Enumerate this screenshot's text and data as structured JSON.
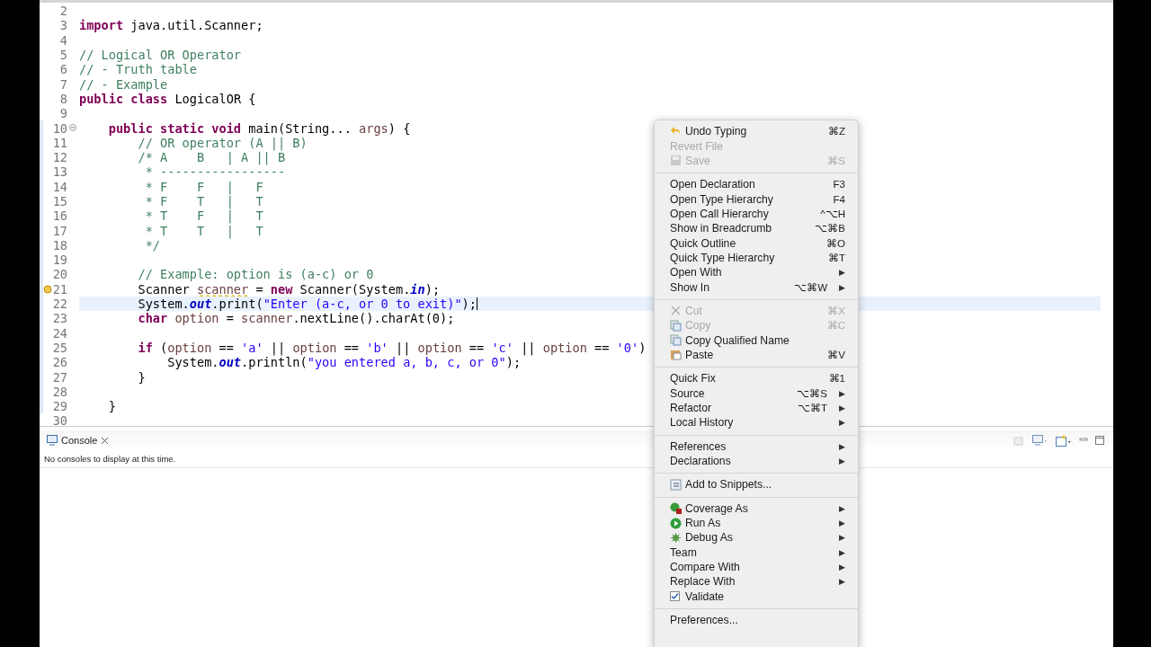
{
  "editor": {
    "lines": [
      {
        "number": "2",
        "current": false
      },
      {
        "number": "3",
        "current": false,
        "tokens": [
          {
            "kind": "keyword",
            "text": "import"
          },
          {
            "kind": "plain",
            "text": " java.util.Scanner;"
          }
        ]
      },
      {
        "number": "4",
        "current": false
      },
      {
        "number": "5",
        "current": false,
        "tokens": [
          {
            "kind": "comment",
            "text": "// Logical OR Operator"
          }
        ]
      },
      {
        "number": "6",
        "current": false,
        "tokens": [
          {
            "kind": "comment",
            "text": "// - Truth table"
          }
        ]
      },
      {
        "number": "7",
        "current": false,
        "tokens": [
          {
            "kind": "comment",
            "text": "// - Example"
          }
        ]
      },
      {
        "number": "8",
        "current": false,
        "tokens": [
          {
            "kind": "keyword",
            "text": "public class"
          },
          {
            "kind": "plain",
            "text": " LogicalOR {"
          }
        ]
      },
      {
        "number": "9",
        "current": false
      },
      {
        "number": "10",
        "current": false,
        "folding": true,
        "tokens": [
          {
            "kind": "keyword",
            "text": "    public static void"
          },
          {
            "kind": "plain",
            "text": " main(String... "
          },
          {
            "kind": "param",
            "text": "args"
          },
          {
            "kind": "plain",
            "text": ") {"
          }
        ]
      },
      {
        "number": "11",
        "current": false,
        "tokens": [
          {
            "kind": "comment",
            "text": "        // OR operator (A || B)"
          }
        ]
      },
      {
        "number": "12",
        "current": false,
        "tokens": [
          {
            "kind": "comment",
            "text": "        /* A    B   | A || B"
          }
        ]
      },
      {
        "number": "13",
        "current": false,
        "tokens": [
          {
            "kind": "comment",
            "text": "         * -----------------"
          }
        ]
      },
      {
        "number": "14",
        "current": false,
        "tokens": [
          {
            "kind": "comment",
            "text": "         * F    F   |   F"
          }
        ]
      },
      {
        "number": "15",
        "current": false,
        "tokens": [
          {
            "kind": "comment",
            "text": "         * F    T   |   T"
          }
        ]
      },
      {
        "number": "16",
        "current": false,
        "tokens": [
          {
            "kind": "comment",
            "text": "         * T    F   |   T"
          }
        ]
      },
      {
        "number": "17",
        "current": false,
        "tokens": [
          {
            "kind": "comment",
            "text": "         * T    T   |   T"
          }
        ]
      },
      {
        "number": "18",
        "current": false,
        "tokens": [
          {
            "kind": "comment",
            "text": "         */"
          }
        ]
      },
      {
        "number": "19",
        "current": false
      },
      {
        "number": "20",
        "current": false,
        "tokens": [
          {
            "kind": "comment",
            "text": "        // Example: option is (a-c) or 0"
          }
        ]
      },
      {
        "number": "21",
        "current": false,
        "warning": true,
        "tokens": [
          {
            "kind": "plain",
            "text": "        Scanner "
          },
          {
            "kind": "warning",
            "text": "scanner"
          },
          {
            "kind": "plain",
            "text": " = "
          },
          {
            "kind": "keyword",
            "text": "new"
          },
          {
            "kind": "plain",
            "text": " Scanner(System."
          },
          {
            "kind": "field",
            "text": "in"
          },
          {
            "kind": "plain",
            "text": ");"
          }
        ]
      },
      {
        "number": "22",
        "current": true,
        "tokens": [
          {
            "kind": "plain",
            "text": "        System."
          },
          {
            "kind": "field",
            "text": "out"
          },
          {
            "kind": "plain",
            "text": ".print("
          },
          {
            "kind": "string",
            "text": "\"Enter (a-c, or 0 to exit)\""
          },
          {
            "kind": "plain",
            "text": ");"
          }
        ]
      },
      {
        "number": "23",
        "current": false,
        "tokens": [
          {
            "kind": "keyword",
            "text": "        char"
          },
          {
            "kind": "param",
            "text": " option"
          },
          {
            "kind": "plain",
            "text": " = "
          },
          {
            "kind": "param",
            "text": "scanner"
          },
          {
            "kind": "plain",
            "text": ".nextLine().charAt(0);"
          }
        ]
      },
      {
        "number": "24",
        "current": false
      },
      {
        "number": "25",
        "current": false,
        "tokens": [
          {
            "kind": "keyword",
            "text": "        if"
          },
          {
            "kind": "plain",
            "text": " ("
          },
          {
            "kind": "param",
            "text": "option"
          },
          {
            "kind": "plain",
            "text": " == "
          },
          {
            "kind": "string",
            "text": "'a'"
          },
          {
            "kind": "plain",
            "text": " || "
          },
          {
            "kind": "param",
            "text": "option"
          },
          {
            "kind": "plain",
            "text": " == "
          },
          {
            "kind": "string",
            "text": "'b'"
          },
          {
            "kind": "plain",
            "text": " || "
          },
          {
            "kind": "param",
            "text": "option"
          },
          {
            "kind": "plain",
            "text": " == "
          },
          {
            "kind": "string",
            "text": "'c'"
          },
          {
            "kind": "plain",
            "text": " || "
          },
          {
            "kind": "param",
            "text": "option"
          },
          {
            "kind": "plain",
            "text": " == "
          },
          {
            "kind": "string",
            "text": "'0'"
          },
          {
            "kind": "plain",
            "text": ")"
          }
        ]
      },
      {
        "number": "26",
        "current": false,
        "tokens": [
          {
            "kind": "plain",
            "text": "            System."
          },
          {
            "kind": "field",
            "text": "out"
          },
          {
            "kind": "plain",
            "text": ".println("
          },
          {
            "kind": "string",
            "text": "\"you entered a, b, c, or 0\""
          },
          {
            "kind": "plain",
            "text": ");"
          }
        ]
      },
      {
        "number": "27",
        "current": false,
        "tokens": [
          {
            "kind": "plain",
            "text": "        }"
          }
        ]
      },
      {
        "number": "28",
        "current": false
      },
      {
        "number": "29",
        "current": false,
        "tokens": [
          {
            "kind": "plain",
            "text": "    }"
          }
        ]
      },
      {
        "number": "30",
        "current": false
      }
    ]
  },
  "console": {
    "tab": "Console",
    "message": "No consoles to display at this time."
  },
  "context_menu": {
    "items": [
      {
        "kind": "item",
        "label": "Undo Typing",
        "shortcut": "⌘Z",
        "disabled": false
      },
      {
        "kind": "item",
        "label": "Revert File",
        "disabled": true
      },
      {
        "kind": "item",
        "label": "Save",
        "shortcut": "⌘S",
        "disabled": true
      },
      {
        "kind": "separator"
      },
      {
        "kind": "item",
        "label": "Open Declaration",
        "shortcut": "F3",
        "disabled": false
      },
      {
        "kind": "item",
        "label": "Open Type Hierarchy",
        "shortcut": "F4",
        "disabled": false
      },
      {
        "kind": "item",
        "label": "Open Call Hierarchy",
        "shortcut": "^⌥H",
        "disabled": false
      },
      {
        "kind": "item",
        "label": "Show in Breadcrumb",
        "shortcut": "⌥⌘B",
        "disabled": false
      },
      {
        "kind": "item",
        "label": "Quick Outline",
        "shortcut": "⌘O",
        "disabled": false
      },
      {
        "kind": "item",
        "label": "Quick Type Hierarchy",
        "shortcut": "⌘T",
        "disabled": false
      },
      {
        "kind": "item",
        "label": "Open With",
        "submenu": "▶",
        "disabled": false
      },
      {
        "kind": "item",
        "label": "Show In",
        "shortcut": "⌥⌘W",
        "submenu": "▶",
        "disabled": false
      },
      {
        "kind": "separator"
      },
      {
        "kind": "item",
        "label": "Cut",
        "shortcut": "⌘X",
        "disabled": true
      },
      {
        "kind": "item",
        "label": "Copy",
        "shortcut": "⌘C",
        "disabled": true
      },
      {
        "kind": "item",
        "label": "Copy Qualified Name",
        "disabled": false
      },
      {
        "kind": "item",
        "label": "Paste",
        "shortcut": "⌘V",
        "disabled": false
      },
      {
        "kind": "separator"
      },
      {
        "kind": "item",
        "label": "Quick Fix",
        "shortcut": "⌘1",
        "disabled": false
      },
      {
        "kind": "item",
        "label": "Source",
        "shortcut": "⌥⌘S",
        "submenu": "▶",
        "disabled": false
      },
      {
        "kind": "item",
        "label": "Refactor",
        "shortcut": "⌥⌘T",
        "submenu": "▶",
        "disabled": false
      },
      {
        "kind": "item",
        "label": "Local History",
        "submenu": "▶",
        "disabled": false
      },
      {
        "kind": "separator"
      },
      {
        "kind": "item",
        "label": "References",
        "submenu": "▶",
        "disabled": false
      },
      {
        "kind": "item",
        "label": "Declarations",
        "submenu": "▶",
        "disabled": false
      },
      {
        "kind": "separator"
      },
      {
        "kind": "item",
        "label": "Add to Snippets...",
        "disabled": false
      },
      {
        "kind": "separator"
      },
      {
        "kind": "item",
        "label": "Coverage As",
        "submenu": "▶",
        "disabled": false
      },
      {
        "kind": "item",
        "label": "Run As",
        "submenu": "▶",
        "disabled": false
      },
      {
        "kind": "item",
        "label": "Debug As",
        "submenu": "▶",
        "disabled": false
      },
      {
        "kind": "item",
        "label": "Team",
        "submenu": "▶",
        "disabled": false
      },
      {
        "kind": "item",
        "label": "Compare With",
        "submenu": "▶",
        "disabled": false
      },
      {
        "kind": "item",
        "label": "Replace With",
        "submenu": "▶",
        "disabled": false
      },
      {
        "kind": "check",
        "label": "Validate",
        "checked": true,
        "disabled": false
      },
      {
        "kind": "separator"
      },
      {
        "kind": "item",
        "label": "Preferences...",
        "disabled": false
      }
    ]
  }
}
